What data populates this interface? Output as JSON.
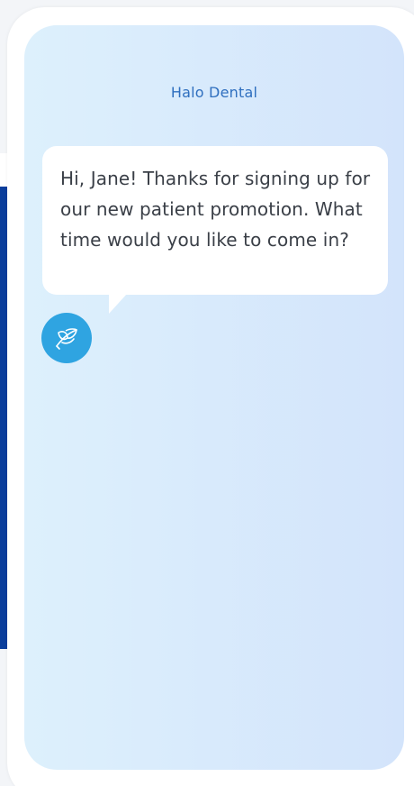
{
  "chat": {
    "title": "Halo Dental",
    "message": "Hi, Jane! Thanks for signing up for our new patient promotion. What time would you like to come in?"
  },
  "avatar": {
    "icon": "leaf-logo-icon",
    "color": "#2fa4e1"
  },
  "colors": {
    "title": "#2f6fbf",
    "screen_gradient_start": "#ddf0fc",
    "screen_gradient_end": "#d3e4fb",
    "sidebar_navy": "#0b3e9c"
  }
}
